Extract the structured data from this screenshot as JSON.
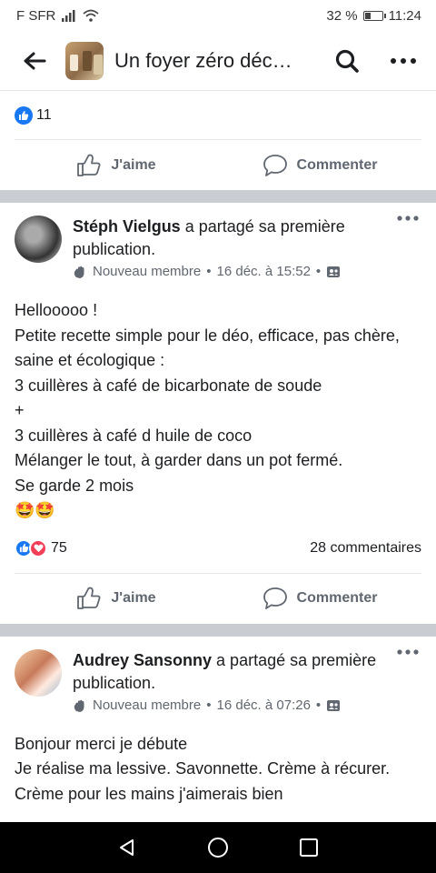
{
  "status_bar": {
    "carrier": "F SFR",
    "battery_percent": "32 %",
    "battery_level": 0.32,
    "time": "11:24"
  },
  "top_bar": {
    "title": "Un foyer zéro déc…"
  },
  "previous_post": {
    "reaction_count": "11",
    "like_label": "J'aime",
    "comment_label": "Commenter"
  },
  "posts": [
    {
      "author": "Stéph Vielgus",
      "action": " a partagé sa première publication.",
      "badge": "Nouveau membre",
      "date": "16 déc. à 15:52",
      "lines": [
        "Hellooooo !",
        "Petite recette simple pour le déo, efficace, pas chère, saine et écologique :",
        "3 cuillères à café de bicarbonate de soude",
        "+",
        "3 cuillères à café d huile de coco",
        "Mélanger le tout, à garder dans un pot fermé.",
        "Se garde 2 mois"
      ],
      "emoji": "🤩🤩",
      "reaction_count": "75",
      "comment_count": "28 commentaires",
      "like_label": "J'aime",
      "comment_label": "Commenter"
    },
    {
      "author": "Audrey Sansonny",
      "action": " a partagé sa première publication.",
      "badge": "Nouveau membre",
      "date": "16 déc. à 07:26",
      "lines": [
        "Bonjour merci je débute",
        "Je réalise ma lessive. Savonnette. Crème à récurer. Crème pour les mains j'aimerais bien"
      ]
    }
  ],
  "nav": {
    "icons": [
      "back-triangle-icon",
      "home-circle-icon",
      "recents-square-icon"
    ]
  }
}
